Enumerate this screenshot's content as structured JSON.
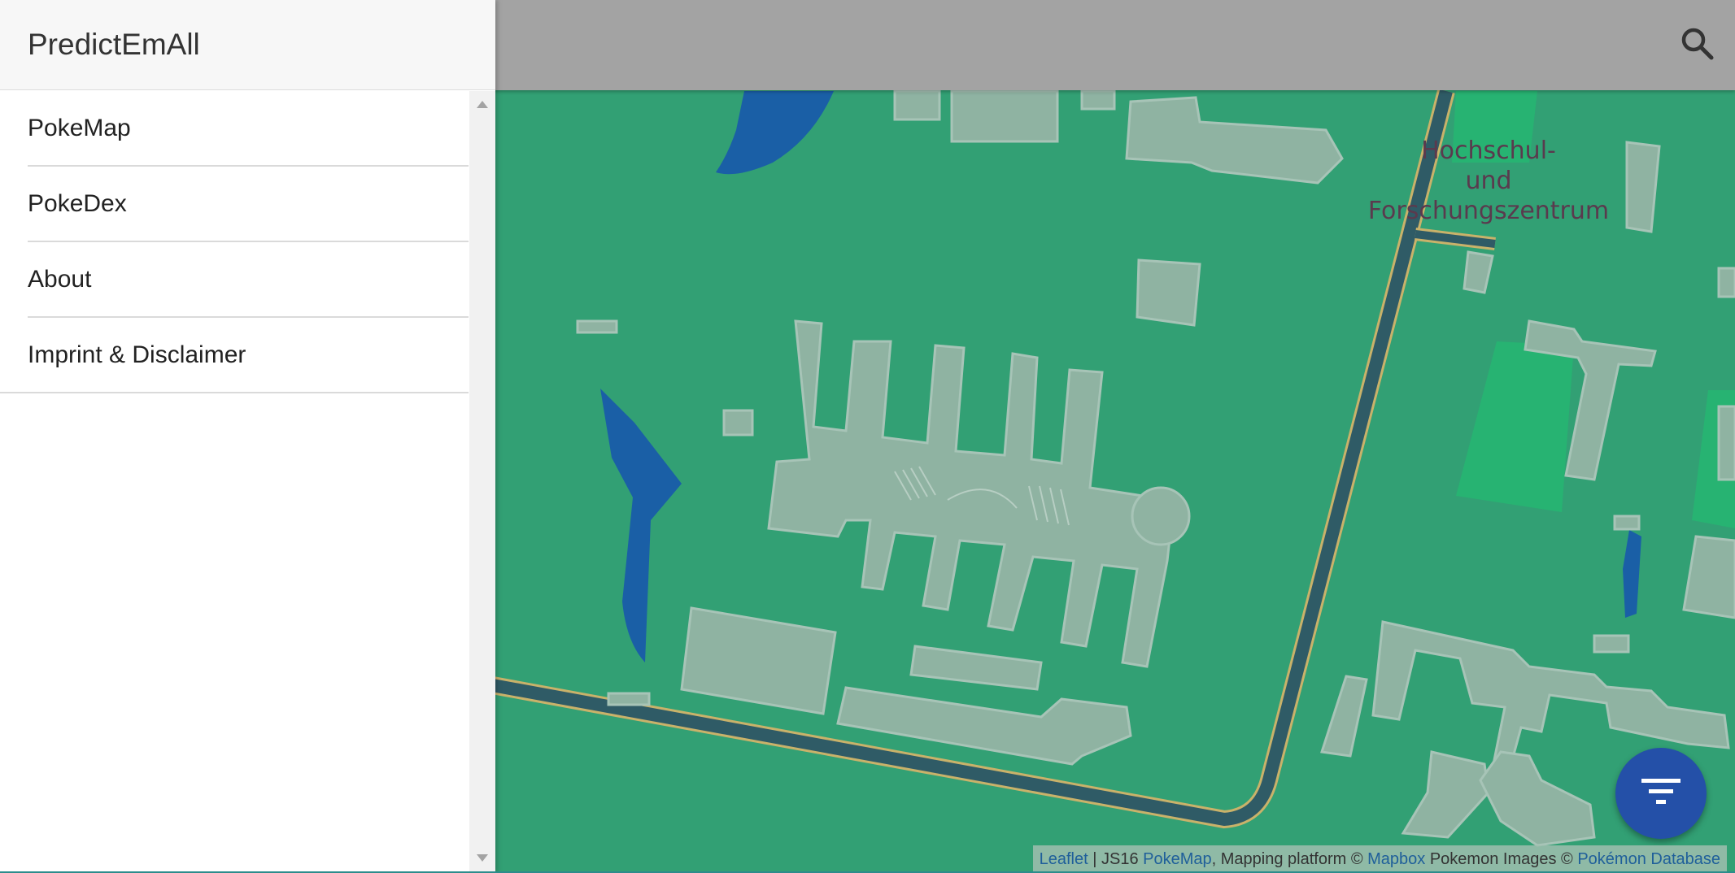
{
  "app": {
    "title": "PredictEmAll"
  },
  "drawer": {
    "items": [
      {
        "label": "PokeMap"
      },
      {
        "label": "PokeDex"
      },
      {
        "label": "About"
      },
      {
        "label": "Imprint & Disclaimer"
      }
    ]
  },
  "appbar": {
    "search_icon": "search-icon"
  },
  "map": {
    "labels": [
      "Hochschul-",
      "und",
      "Forschungszentrum"
    ],
    "colors": {
      "grass": "#2f9a6f",
      "water": "#1a5fa6",
      "building": "#8fb3a2",
      "road": "#2f5b66"
    }
  },
  "fab": {
    "icon": "filter-icon"
  },
  "attribution": {
    "leaflet": "Leaflet",
    "sep1": " | JS16 ",
    "pokemap": "PokeMap",
    "mapping": ", Mapping platform © ",
    "mapbox": "Mapbox",
    "images": " Pokemon Images © ",
    "pokemon_db": "Pokémon Database"
  },
  "colors": {
    "appbar": "#a3a3a3",
    "fab": "#2450a8",
    "accent_link": "#1f5f9a"
  }
}
